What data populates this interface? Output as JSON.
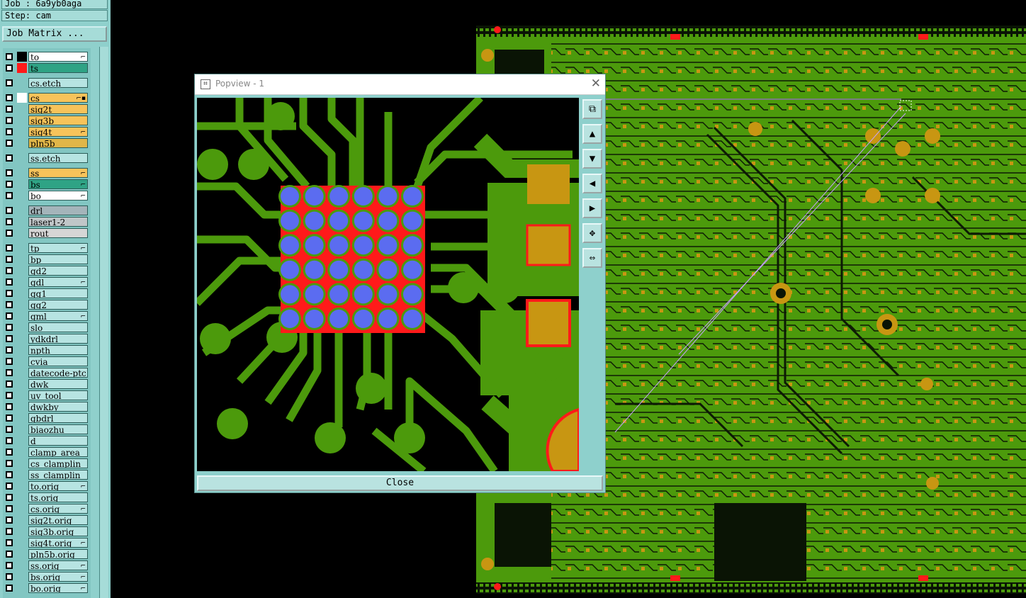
{
  "sidebar": {
    "job_label": "Job : 6a9yb0aga",
    "step_label": "Step: cam",
    "job_matrix_button": "Job Matrix ...",
    "layers": [
      {
        "name": "to",
        "color": "#ffffff",
        "swatch": "#000000",
        "marker": "⌐"
      },
      {
        "name": "ts",
        "color": "#2fa385",
        "swatch": "#ff1a1a",
        "marker": ""
      },
      {
        "name": "cs.etch",
        "color": "#b7e4e2",
        "swatch": "",
        "marker": ""
      },
      {
        "name": "cs",
        "color": "#f7c35a",
        "swatch": "#ffffff",
        "marker": "⌐▪"
      },
      {
        "name": "sig2t",
        "color": "#f7c35a",
        "swatch": "",
        "marker": ""
      },
      {
        "name": "sig3b",
        "color": "#f7c35a",
        "swatch": "",
        "marker": ""
      },
      {
        "name": "sig4t",
        "color": "#f7c35a",
        "swatch": "",
        "marker": "⌐"
      },
      {
        "name": "pln5b",
        "color": "#e0b648",
        "swatch": "",
        "marker": ""
      },
      {
        "name": "ss.etch",
        "color": "#b7e4e2",
        "swatch": "",
        "marker": ""
      },
      {
        "name": "ss",
        "color": "#f7c35a",
        "swatch": "",
        "marker": "⌐"
      },
      {
        "name": "bs",
        "color": "#2fa385",
        "swatch": "",
        "marker": "⌐"
      },
      {
        "name": "bo",
        "color": "#ffffff",
        "swatch": "",
        "marker": "⌐"
      },
      {
        "name": "drl",
        "color": "#a4b4ba",
        "swatch": "",
        "marker": ""
      },
      {
        "name": "laser1-2",
        "color": "#c0c6c8",
        "swatch": "",
        "marker": ""
      },
      {
        "name": "rout",
        "color": "#d6d6d6",
        "swatch": "",
        "marker": ""
      },
      {
        "name": "tp",
        "color": "#b7e4e2",
        "swatch": "",
        "marker": "⌐"
      },
      {
        "name": "bp",
        "color": "#b7e4e2",
        "swatch": "",
        "marker": ""
      },
      {
        "name": "gd2",
        "color": "#b7e4e2",
        "swatch": "",
        "marker": ""
      },
      {
        "name": "gdl",
        "color": "#b7e4e2",
        "swatch": "",
        "marker": "⌐"
      },
      {
        "name": "gg1",
        "color": "#b7e4e2",
        "swatch": "",
        "marker": ""
      },
      {
        "name": "gg2",
        "color": "#b7e4e2",
        "swatch": "",
        "marker": ""
      },
      {
        "name": "gml",
        "color": "#b7e4e2",
        "swatch": "",
        "marker": "⌐"
      },
      {
        "name": "slo",
        "color": "#b7e4e2",
        "swatch": "",
        "marker": ""
      },
      {
        "name": "ydkdrl",
        "color": "#b7e4e2",
        "swatch": "",
        "marker": ""
      },
      {
        "name": "npth",
        "color": "#b7e4e2",
        "swatch": "",
        "marker": ""
      },
      {
        "name": "cvia",
        "color": "#b7e4e2",
        "swatch": "",
        "marker": ""
      },
      {
        "name": "datecode-ptc",
        "color": "#b7e4e2",
        "swatch": "",
        "marker": ""
      },
      {
        "name": "dwk",
        "color": "#b7e4e2",
        "swatch": "",
        "marker": ""
      },
      {
        "name": "uv_tool",
        "color": "#b7e4e2",
        "swatch": "",
        "marker": ""
      },
      {
        "name": "dwkby",
        "color": "#b7e4e2",
        "swatch": "",
        "marker": ""
      },
      {
        "name": "gbdrl",
        "color": "#b7e4e2",
        "swatch": "",
        "marker": ""
      },
      {
        "name": "biaozhu",
        "color": "#b7e4e2",
        "swatch": "",
        "marker": ""
      },
      {
        "name": "d",
        "color": "#b7e4e2",
        "swatch": "",
        "marker": ""
      },
      {
        "name": "clamp_area",
        "color": "#b7e4e2",
        "swatch": "",
        "marker": ""
      },
      {
        "name": "cs_clamplin",
        "color": "#b7e4e2",
        "swatch": "",
        "marker": ""
      },
      {
        "name": "ss_clamplin",
        "color": "#b7e4e2",
        "swatch": "",
        "marker": ""
      },
      {
        "name": "to.orig",
        "color": "#b7e4e2",
        "swatch": "",
        "marker": "⌐"
      },
      {
        "name": "ts.orig",
        "color": "#b7e4e2",
        "swatch": "",
        "marker": ""
      },
      {
        "name": "cs.orig",
        "color": "#b7e4e2",
        "swatch": "",
        "marker": "⌐"
      },
      {
        "name": "sig2t.orig",
        "color": "#b7e4e2",
        "swatch": "",
        "marker": ""
      },
      {
        "name": "sig3b.orig",
        "color": "#b7e4e2",
        "swatch": "",
        "marker": ""
      },
      {
        "name": "sig4t.orig",
        "color": "#b7e4e2",
        "swatch": "",
        "marker": "⌐"
      },
      {
        "name": "pln5b.orig",
        "color": "#b7e4e2",
        "swatch": "",
        "marker": ""
      },
      {
        "name": "ss.orig",
        "color": "#b7e4e2",
        "swatch": "",
        "marker": "⌐"
      },
      {
        "name": "bs.orig",
        "color": "#b7e4e2",
        "swatch": "",
        "marker": "⌐"
      },
      {
        "name": "bo.orig",
        "color": "#b7e4e2",
        "swatch": "",
        "marker": "⌐"
      }
    ]
  },
  "popview": {
    "title": "Popview - 1",
    "close_label": "Close",
    "toolbar_icons": [
      "zoom-window-icon",
      "pan-up-icon",
      "pan-down-icon",
      "pan-left-icon",
      "pan-right-icon",
      "zoom-fit-icon",
      "center-icon"
    ]
  },
  "colors": {
    "copper": "#4c9a0c",
    "pad_gold": "#c89612",
    "bga_pad": "#5b6cf0",
    "mask_ring": "#ff1a1a",
    "panel_teal": "#8ed0cc"
  }
}
